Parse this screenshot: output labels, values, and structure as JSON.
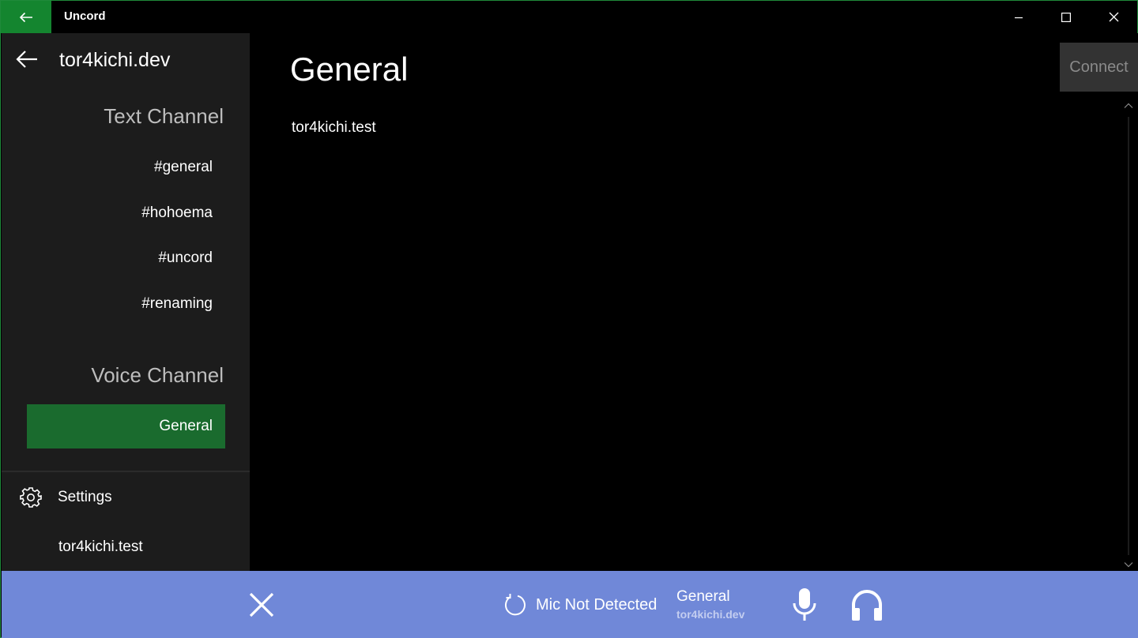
{
  "app": {
    "title": "Uncord"
  },
  "sidebar": {
    "server_name": "tor4kichi.dev",
    "text_header": "Text Channel",
    "text_channels": [
      "#general",
      "#hohoema",
      "#uncord",
      "#renaming"
    ],
    "voice_header": "Voice Channel",
    "voice_channels": [
      "General"
    ],
    "settings_label": "Settings",
    "user_name": "tor4kichi.test"
  },
  "main": {
    "channel_title": "General",
    "messages": [
      "tor4kichi.test"
    ],
    "connect_label": "Connect"
  },
  "voice_bar": {
    "mic_status": "Mic Not Detected",
    "channel_name": "General",
    "server_name": "tor4kichi.dev"
  },
  "colors": {
    "accent": "#14852f",
    "selected_channel": "#1a6b2e",
    "voice_bar": "#7088d8"
  }
}
